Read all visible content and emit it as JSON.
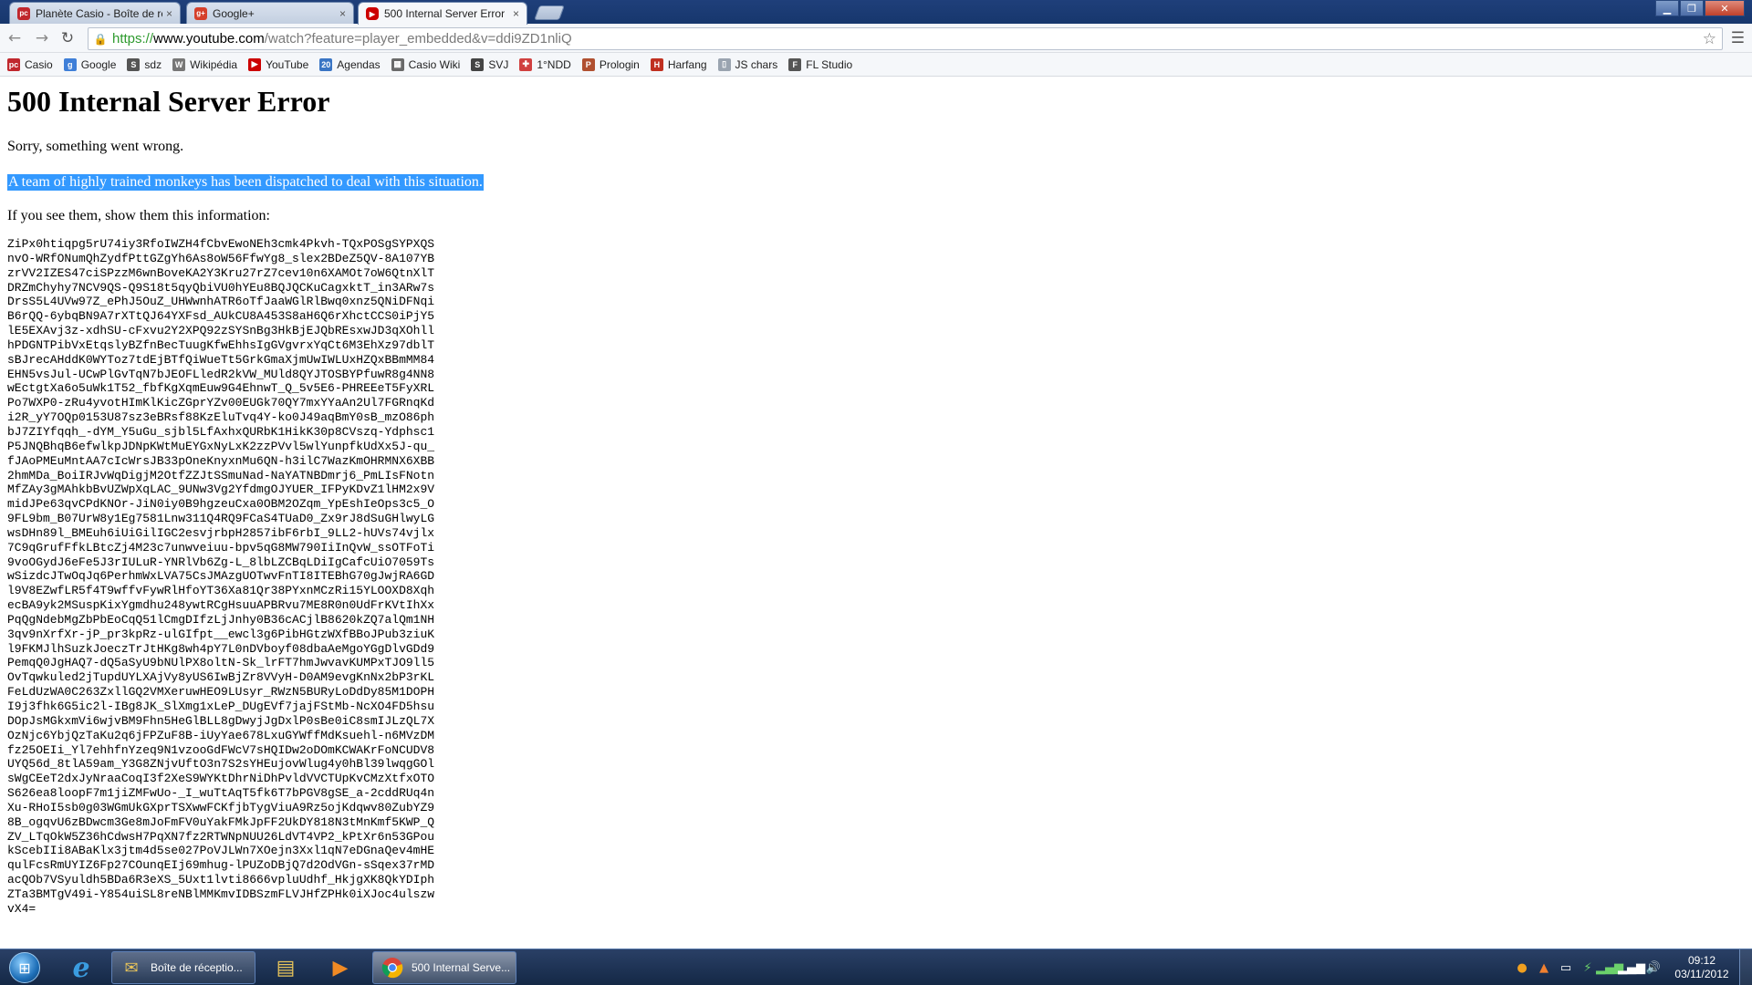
{
  "browser": {
    "tabs": [
      {
        "title": "Planète Casio - Boîte de ré",
        "favicon": "planete-casio-favicon",
        "active": false
      },
      {
        "title": "Google+",
        "favicon": "google-plus-favicon",
        "active": false
      },
      {
        "title": "500 Internal Server Error",
        "favicon": "youtube-favicon",
        "active": true
      }
    ],
    "close_glyph": "×",
    "address": {
      "scheme": "https://",
      "host": "www.youtube.com",
      "path": "/watch?feature=player_embedded&v=ddi9ZD1nliQ"
    }
  },
  "bookmarks": [
    {
      "label": "Casio",
      "icon": "pc-icon",
      "color": "#c0272d",
      "glyph": "pc"
    },
    {
      "label": "Google",
      "icon": "google-icon",
      "color": "#3f7fd8",
      "glyph": "g"
    },
    {
      "label": "sdz",
      "icon": "sdz-icon",
      "color": "#555555",
      "glyph": "S"
    },
    {
      "label": "Wikipédia",
      "icon": "wikipedia-icon",
      "color": "#777777",
      "glyph": "W"
    },
    {
      "label": "YouTube",
      "icon": "youtube-icon",
      "color": "#cc0000",
      "glyph": "▶"
    },
    {
      "label": "Agendas",
      "icon": "calendar-icon",
      "color": "#3a75c4",
      "glyph": "20"
    },
    {
      "label": "Casio Wiki",
      "icon": "casio-wiki-icon",
      "color": "#6a6a6a",
      "glyph": "▦"
    },
    {
      "label": "SVJ",
      "icon": "svj-icon",
      "color": "#444444",
      "glyph": "S"
    },
    {
      "label": "1°NDD",
      "icon": "ndd-icon",
      "color": "#d04040",
      "glyph": "✚"
    },
    {
      "label": "Prologin",
      "icon": "prologin-icon",
      "color": "#b05030",
      "glyph": "P"
    },
    {
      "label": "Harfang",
      "icon": "harfang-icon",
      "color": "#c03020",
      "glyph": "H"
    },
    {
      "label": "JS chars",
      "icon": "page-icon",
      "color": "#9aa4b0",
      "glyph": "▯"
    },
    {
      "label": "FL Studio",
      "icon": "fl-studio-icon",
      "color": "#555555",
      "glyph": "F"
    }
  ],
  "page": {
    "heading": "500 Internal Server Error",
    "message": "Sorry, something went wrong.",
    "highlighted": "A team of highly trained monkeys has been dispatched to deal with this situation.",
    "prompt": "If you see them, show them this information:",
    "debug_lines": [
      "ZiPx0htiqpg5rU74iy3RfoIWZH4fCbvEwoNEh3cmk4Pkvh-TQxPOSgSYPXQS",
      "nvO-WRfONumQhZydfPttGZgYh6As8oW56FfwYg8_slex2BDeZ5QV-8A107YB",
      "zrVV2IZES47ciSPzzM6wnBoveKA2Y3Kru27rZ7cev10n6XAMOt7oW6QtnXlT",
      "DRZmChyhy7NCV9QS-Q9S18t5qyQbiVU0hYEu8BQJQCKuCagxktT_in3ARw7s",
      "DrsS5L4UVw97Z_ePhJ5OuZ_UHWwnhATR6oTfJaaWGlRlBwq0xnz5QNiDFNqi",
      "B6rQQ-6ybqBN9A7rXTtQJ64YXFsd_AUkCU8A453S8aH6Q6rXhctCCS0iPjY5",
      "lE5EXAvj3z-xdhSU-cFxvu2Y2XPQ92zSYSnBg3HkBjEJQbREsxwJD3qXOhll",
      "hPDGNTPibVxEtqslyBZfnBecTuugKfwEhhsIgGVgvrxYqCt6M3EhXz97dblT",
      "sBJrecAHddK0WYToz7tdEjBTfQiWueTt5GrkGmaXjmUwIWLUxHZQxBBmMM84",
      "EHN5vsJul-UCwPlGvTqN7bJEOFLledR2kVW_MUld8QYJTOSBYPfuwR8g4NN8",
      "wEctgtXa6o5uWk1T52_fbfKgXqmEuw9G4EhnwT_Q_5v5E6-PHREEeT5FyXRL",
      "Po7WXP0-zRu4yvotHImKlKicZGprYZv00EUGk70QY7mxYYaAn2Ul7FGRnqKd",
      "i2R_yY7OQp0153U87sz3eBRsf88KzEluTvq4Y-ko0J49aqBmY0sB_mzO86ph",
      "bJ7ZIYfqqh_-dYM_Y5uGu_sjbl5LfAxhxQURbK1HikK30p8CVszq-Ydphsc1",
      "P5JNQBhqB6efwlkpJDNpKWtMuEYGxNyLxK2zzPVvl5wlYunpfkUdXx5J-qu_",
      "fJAoPMEuMntAA7cIcWrsJB33pOneKnyxnMu6QN-h3ilC7WazKmOHRMNX6XBB",
      "2hmMDa_BoiIRJvWqDigjM2OtfZZJtSSmuNad-NaYATNBDmrj6_PmLIsFNotn",
      "MfZAy3gMAhkbBvUZWpXqLAC_9UNw3Vg2YfdmgOJYUER_IFPyKDvZ1lHM2x9V",
      "midJPe63qvCPdKNOr-JiN0iy0B9hgzeuCxa0OBM2OZqm_YpEshIeOps3c5_O",
      "9FL9bm_B07UrW8y1Eg7581Lnw311Q4RQ9FCaS4TUaD0_Zx9rJ8dSuGHlwyLG",
      "wsDHn89l_BMEuh6iUiGilIGC2esvjrbpH2857ibF6rbI_9LL2-hUVs74vjlx",
      "7C9qGrufFfkLBtcZj4M23c7unwveiuu-bpv5qG8MW790IiInQvW_ssOTFoTi",
      "9voOGydJ6eFe5J3rIULuR-YNRlVb6Zg-L_8lbLZCBqLDiIgCafcUiO7059Ts",
      "wSizdcJTwOqJq6PerhmWxLVA75CsJMAzgUOTwvFnTI8ITEBhG70gJwjRA6GD",
      "l9V8EZwfLR5f4T9wffvFywRlHfoYT36Xa81Qr38PYxnMCzRi15YLOOXD8Xqh",
      "ecBA9yk2MSuspKixYgmdhu248ywtRCgHsuuAPBRvu7ME8R0n0UdFrKVtIhXx",
      "PqQgNdebMgZbPbEoCqQ51lCmgDIfzLjJnhy0B36cACjlB8620kZQ7alQm1NH",
      "3qv9nXrfXr-jP_pr3kpRz-ulGIfpt__ewcl3g6PibHGtzWXfBBoJPub3ziuK",
      "l9FKMJlhSuzkJoeczTrJtHKg8wh4pY7L0nDVboyf08dbaAeMgoYGgDlvGDd9",
      "PemqQ0JgHAQ7-dQ5aSyU9bNUlPX8oltN-Sk_lrFT7hmJwvavKUMPxTJO9ll5",
      "OvTqwkuled2jTupdUYLXAjVy8yUS6IwBjZr8VVyH-D0AM9evgKnNx2bP3rKL",
      "FeLdUzWA0C263ZxllGQ2VMXeruwHEO9LUsyr_RWzN5BURyLoDdDy85M1DOPH",
      "I9j3fhk6G5ic2l-IBg8JK_SlXmg1xLeP_DUgEVf7jajFStMb-NcXO4FD5hsu",
      "DOpJsMGkxmVi6wjvBM9Fhn5HeGlBLL8gDwyjJgDxlP0sBe0iC8smIJLzQL7X",
      "OzNjc6YbjQzTaKu2q6jFPZuF8B-iUyYae678LxuGYWffMdKsuehl-n6MVzDM",
      "fz25OEIi_Yl7ehhfnYzeq9N1vzooGdFWcV7sHQIDw2oDOmKCWAKrFoNCUDV8",
      "UYQ56d_8tlA59am_Y3G8ZNjvUftO3n7S2sYHEujovWlug4y0hBl39lwqgGOl",
      "sWgCEeT2dxJyNraaCoqI3f2XeS9WYKtDhrNiDhPvldVVCTUpKvCMzXtfxOTO",
      "S626ea8loopF7m1jiZMFwUo-_I_wuTtAqT5fk6T7bPGV8gSE_a-2cddRUq4n",
      "Xu-RHoI5sb0g03WGmUkGXprTSXwwFCKfjbTygViuA9Rz5ojKdqwv80ZubYZ9",
      "8B_ogqvU6zBDwcm3Ge8mJoFmFV0uYakFMkJpFF2UkDY818N3tMnKmf5KWP_Q",
      "ZV_LTqOkW5Z36hCdwsH7PqXN7fz2RTWNpNUU26LdVT4VP2_kPtXr6n53GPou",
      "kScebIIi8ABaKlx3jtm4d5se027PoVJLWn7XOejn3Xxl1qN7eDGnaQev4mHE",
      "qulFcsRmUYIZ6Fp27COunqEIj69mhug-lPUZoDBjQ7d2OdVGn-sSqex37rMD",
      "acQOb7VSyuldh5BDa6R3eXS_5Uxt1lvti8666vpluUdhf_HkjgXK8QkYDIph",
      "ZTa3BMTgV49i-Y854uiSL8reNBlMMKmvIDBSzmFLVJHfZPHk0iXJoc4ulszw",
      "vX4="
    ]
  },
  "taskbar": {
    "pinned": [
      {
        "name": "internet-explorer-icon",
        "glyph": "e",
        "color": "#3a9ce0"
      },
      {
        "name": "windows-explorer-icon",
        "glyph": "▤",
        "color": "#e8c45a"
      },
      {
        "name": "media-player-icon",
        "glyph": "▶",
        "color": "#f08a24"
      }
    ],
    "tasks": [
      {
        "label": "Boîte de réceptio...",
        "icon": "mail-folder-icon",
        "active": false
      },
      {
        "label": "500 Internal Serve...",
        "icon": "chrome-icon",
        "active": true
      }
    ],
    "clock": {
      "time": "09:12",
      "date": "03/11/2012"
    }
  }
}
